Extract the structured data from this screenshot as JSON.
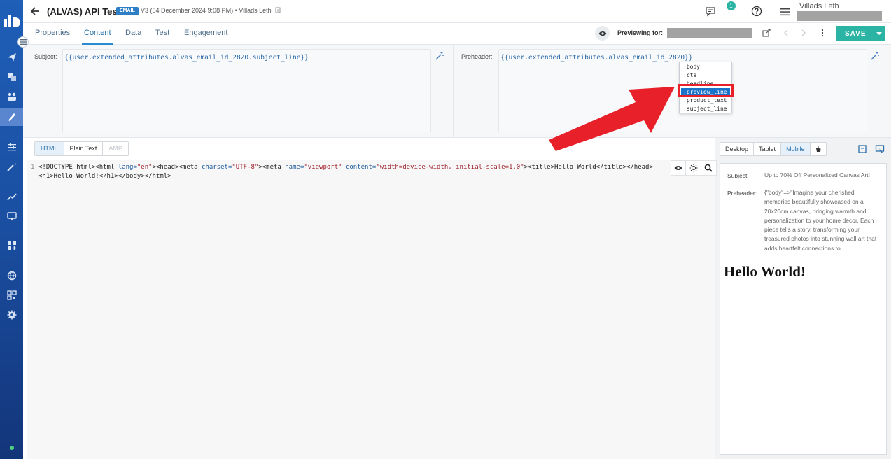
{
  "header": {
    "title": "(ALVAS) API Test",
    "badge": "EMAIL",
    "version": "V3 (04 December 2024 9:08 PM)",
    "author": "Villads Leth",
    "notification_count": "1",
    "user_name": "Villads Leth"
  },
  "tabs": [
    {
      "label": "Properties"
    },
    {
      "label": "Content",
      "active": true
    },
    {
      "label": "Data"
    },
    {
      "label": "Test"
    },
    {
      "label": "Engagement"
    }
  ],
  "preview": {
    "label": "Previewing for:"
  },
  "save": {
    "label": "SAVE"
  },
  "subject": {
    "label": "Subject:",
    "value": "{{user.extended_attributes.alvas_email_id_2820.subject_line}}"
  },
  "preheader": {
    "label": "Preheader:",
    "value": "{{user.extended_attributes.alvas_email_id_2820}}"
  },
  "autocomplete": {
    "items": [
      ".body",
      ".cta",
      ".headline",
      ".preview_line",
      ".product_text",
      ".subject_line"
    ],
    "selected_index": 3
  },
  "editor": {
    "formats": [
      "HTML",
      "Plain Text",
      "AMP"
    ],
    "active_format": "HTML",
    "line_number": "1",
    "code_line1_a": "<!DOCTYPE html><html ",
    "code_line1_attr1": "lang=",
    "code_line1_str1": "\"en\"",
    "code_line1_b": "><head><meta ",
    "code_line1_attr2": "charset=",
    "code_line1_str2": "\"UTF-8\"",
    "code_line1_c": "><meta ",
    "code_line1_attr3": "name=",
    "code_line1_str3": "\"viewport\"",
    "code_line1_d": " ",
    "code_line1_attr4": "content=",
    "code_line1_str4": "\"width=device-width, initial-scale=1.0\"",
    "code_line1_e": "><title>Hello World</title></head>",
    "code_line2": "<h1>Hello World!</h1></body></html>"
  },
  "preview_panel": {
    "devices": [
      "Desktop",
      "Tablet",
      "Mobile"
    ],
    "active_device": "Mobile",
    "subject_label": "Subject:",
    "subject_value": "Up to 70% Off Personalized Canvas Art!",
    "preheader_label": "Preheader:",
    "preheader_value": "{\"body\"=>\"Imagine your cherished memories beautifully showcased on a 20x20cm canvas, bringing warmth and personalization to your home decor. Each piece tells a story, transforming your treasured photos into stunning wall art that adds heartfelt connections to",
    "heading": "Hello World!"
  },
  "colors": {
    "rail": "#1a4ea0",
    "accent": "#2bb3a3",
    "link_blue": "#2b8ad2",
    "highlight_red": "#e8202a"
  }
}
